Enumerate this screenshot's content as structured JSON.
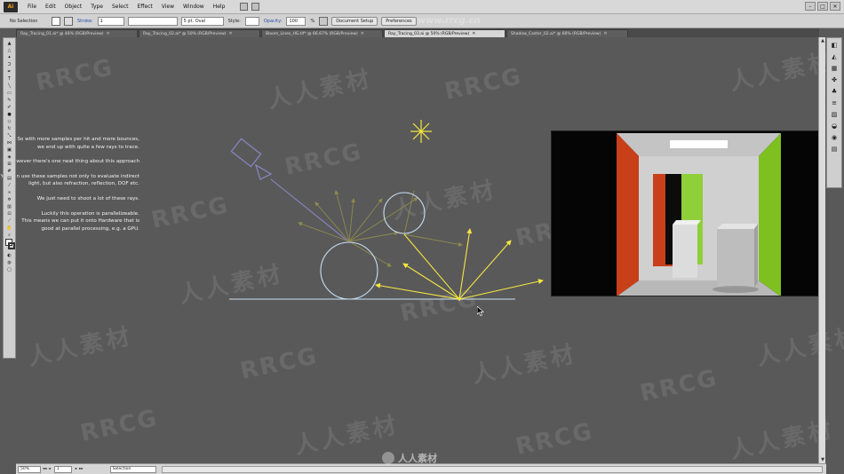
{
  "menubar": {
    "logo": "Ai",
    "items": [
      "File",
      "Edit",
      "Object",
      "Type",
      "Select",
      "Effect",
      "View",
      "Window",
      "Help"
    ],
    "window_controls": [
      "–",
      "□",
      "✕"
    ]
  },
  "controlbar": {
    "selection": "No Selection",
    "stroke_label": "Stroke:",
    "stroke_value": "1",
    "brush": "5 pt. Oval",
    "style_label": "Style:",
    "opacity_label": "Opacity:",
    "opacity_value": "100",
    "opacity_unit": "%",
    "document_setup": "Document Setup",
    "preferences": "Preferences"
  },
  "tabs": [
    {
      "label": "Ray_Tracing_01.ai* @ 48% (RGB/Preview)",
      "active": false
    },
    {
      "label": "Ray_Tracing_02.ai* @ 50% (RGB/Preview)",
      "active": false
    },
    {
      "label": "Bloom_Lines_HG.tif* @ 66.67% (RGB/Preview)",
      "active": false
    },
    {
      "label": "Ray_Tracing_03.ai @ 50% (RGB/Preview)",
      "active": true
    },
    {
      "label": "Shadow_Caster_02.ai* @ 66% (RGB/Preview)",
      "active": false
    }
  ],
  "slide_text": {
    "para1": [
      "So with more samples per hit and more bounces,",
      "we end up with quite a few rays to trace."
    ],
    "para2": [
      "However there's one neat thing about this approach"
    ],
    "para3": [
      "You can use these samples not only to evaluate indirect",
      "light, but also refraction, reflection, DOF etc."
    ],
    "para4": [
      "We just need to shoot a lot of these rays."
    ],
    "para5": [
      "Luckily this operation is parallelizeable.",
      "This means we can put it onto Hardware that is",
      "good at parallel processing, e.g. a GPU."
    ]
  },
  "statusbar": {
    "zoom": "50%",
    "artboard": "1",
    "tool": "Selection"
  },
  "watermarks": {
    "latin": "RRCG",
    "cjk": "人人素材",
    "site": "www.rrcg.cn",
    "bottom": "人人素材"
  },
  "colors": {
    "canvas_bg": "#595959",
    "ray_yellow": "#f5e642",
    "ray_dim": "#9e9a52",
    "sphere_outline": "#c8e0f4",
    "camera_purple": "#8a86c8",
    "wall_red": "#c8401a",
    "wall_green": "#7ec020"
  }
}
